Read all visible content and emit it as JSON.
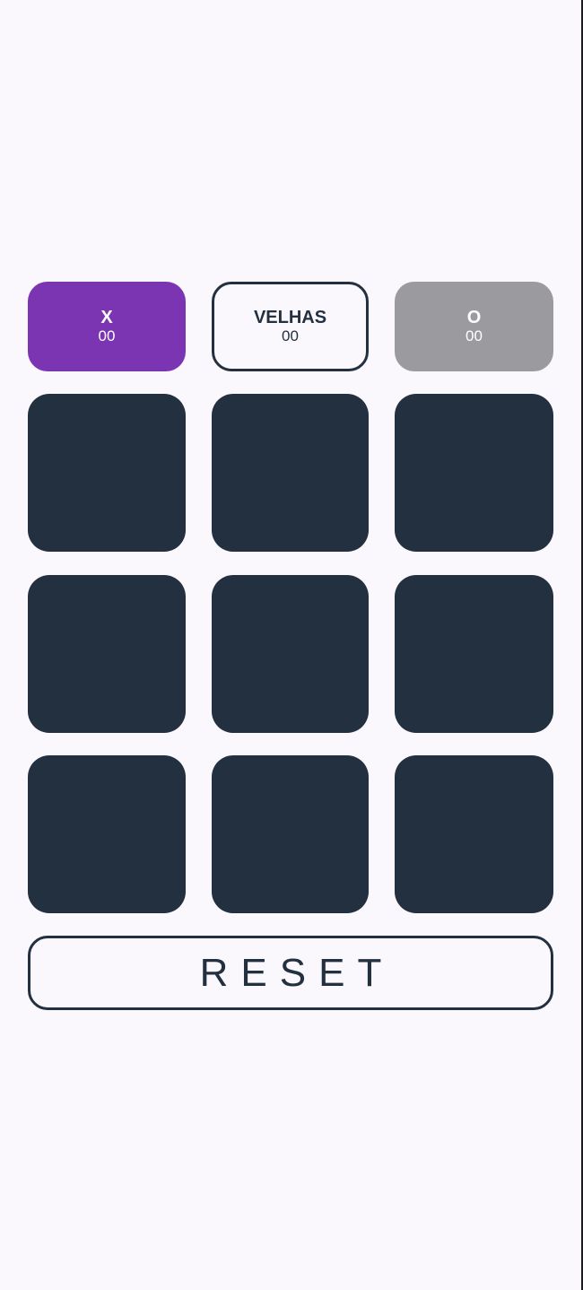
{
  "scoreboard": {
    "x": {
      "label": "X",
      "value": "00"
    },
    "draws": {
      "label": "VELHAS",
      "value": "00"
    },
    "o": {
      "label": "O",
      "value": "00"
    }
  },
  "board": {
    "cells": [
      "",
      "",
      "",
      "",
      "",
      "",
      "",
      "",
      ""
    ]
  },
  "actions": {
    "reset_label": "RESET"
  },
  "colors": {
    "background": "#fbf8fd",
    "x_score": "#7b35b3",
    "o_score": "#9b9a9f",
    "cell": "#233040",
    "outline": "#23303f"
  }
}
